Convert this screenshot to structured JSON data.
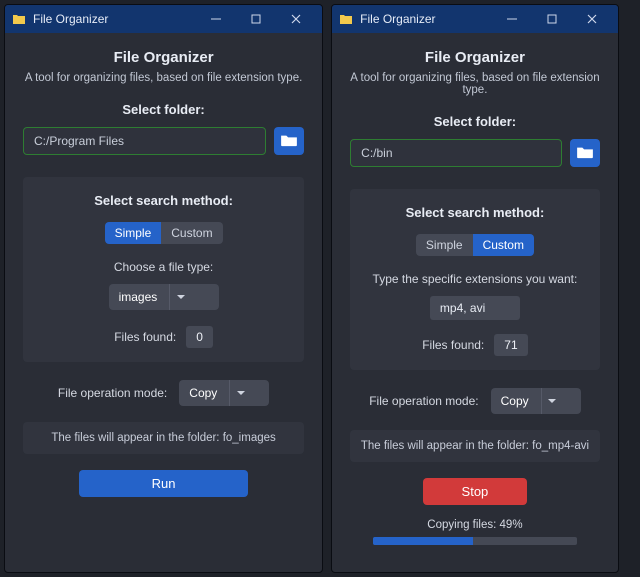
{
  "colors": {
    "accent": "#2563c9",
    "danger": "#d23a3a",
    "ok_border": "#2e7d32"
  },
  "left": {
    "titlebar": {
      "title": "File Organizer"
    },
    "header": {
      "title": "File Organizer",
      "subtitle": "A tool for organizing files, based on file extension type."
    },
    "folder": {
      "label": "Select folder:",
      "value": "C:/Program Files"
    },
    "search": {
      "title": "Select search method:",
      "tabs": {
        "simple": "Simple",
        "custom": "Custom",
        "active": "simple"
      },
      "simple": {
        "prompt": "Choose a file type:",
        "selected": "images",
        "count_label": "Files found:",
        "count": "0"
      }
    },
    "mode": {
      "label": "File operation mode:",
      "selected": "Copy"
    },
    "info": "The files will appear in the folder: fo_images",
    "action": {
      "label": "Run",
      "kind": "run"
    }
  },
  "right": {
    "titlebar": {
      "title": "File Organizer"
    },
    "header": {
      "title": "File Organizer",
      "subtitle": "A tool for organizing files, based on file extension type."
    },
    "folder": {
      "label": "Select folder:",
      "value": "C:/bin"
    },
    "search": {
      "title": "Select search method:",
      "tabs": {
        "simple": "Simple",
        "custom": "Custom",
        "active": "custom"
      },
      "custom": {
        "prompt": "Type the specific extensions you want:",
        "value": "mp4, avi",
        "count_label": "Files found:",
        "count": "71"
      }
    },
    "mode": {
      "label": "File operation mode:",
      "selected": "Copy"
    },
    "info": "The files will appear in the folder: fo_mp4-avi",
    "action": {
      "label": "Stop",
      "kind": "stop"
    },
    "progress": {
      "label": "Copying files: 49%",
      "percent": 49
    }
  }
}
